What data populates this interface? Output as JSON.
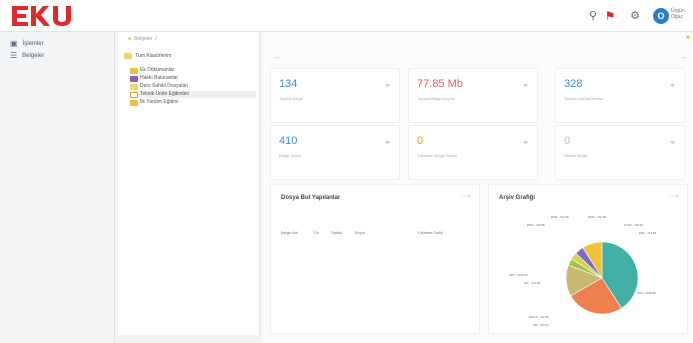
{
  "brand": {
    "logo_text": "EKU",
    "logo_color": "#e02a2a"
  },
  "header": {
    "icons": [
      "search-icon",
      "notification-icon",
      "settings-icon"
    ],
    "avatar_initial": "O",
    "user_name": "Ürgün Oğuz"
  },
  "sidebar": {
    "items": [
      {
        "label": "İşlemler",
        "icon": "briefcase-icon"
      },
      {
        "label": "Belgeler",
        "icon": "list-icon"
      }
    ]
  },
  "tree": {
    "breadcrumb": "Belgeler",
    "root": "Tüm Klasörlerim",
    "items": [
      {
        "label": "Ek Dökümanlar",
        "icon": "folder",
        "selected": false
      },
      {
        "label": "Hakkı Bulunanlar",
        "icon": "folder-purple",
        "selected": false
      },
      {
        "label": "Ders Sahibi Dosyaları",
        "icon": "folder-open",
        "selected": false
      },
      {
        "label": "Teknik Ünite Eğitimleri",
        "icon": "folder-outline",
        "selected": true
      },
      {
        "label": "İlk Yardım Eğitimi",
        "icon": "folder",
        "selected": false
      }
    ]
  },
  "cards": [
    {
      "value": "134",
      "label": "Toplam Belge",
      "color": "#3d8fd6"
    },
    {
      "value": "77.85 Mb",
      "label": "Toplam Belge Boyutu",
      "color": "#e85c5c"
    },
    {
      "value": "328",
      "label": "Toplam Görüntülenme",
      "color": "#3d8fd6"
    },
    {
      "value": "410",
      "label": "Belge Sayısı",
      "color": "#3d8fd6"
    },
    {
      "value": "0",
      "label": "Yüklenen Belge Sayısı",
      "color": "#f0a020"
    },
    {
      "value": "0",
      "label": "Silinen Belge",
      "color": "#bbbbbb"
    }
  ],
  "table_panel": {
    "title": "Dosya Bul Yapılanlar",
    "columns": [
      "Belge Adı",
      "Tür",
      "Sahibi",
      "Boyut",
      "Yükleme Tarihi"
    ]
  },
  "pie_panel": {
    "title": "Arşiv Grafiği",
    "labels": [
      "DMF - %2.46",
      "PNG - %5.85",
      "DMG - %0.96",
      "XLSX - %0.32",
      "PDF - %4.81",
      "JPG - %40.86",
      "GIF - %3.06",
      "PPT - %25.92",
      "DOCX - %1.83",
      "ZIP - %3.21",
      "PNG - %5.56"
    ]
  },
  "chart_data": {
    "type": "pie",
    "title": "Arşiv Grafiği",
    "series": [
      {
        "name": "JPG",
        "value": 40.86,
        "color": "#43b0a5"
      },
      {
        "name": "PPT",
        "value": 25.92,
        "color": "#ee8050"
      },
      {
        "name": "PNG",
        "value": 14.0,
        "color": "#c8b870"
      },
      {
        "name": "DOCX",
        "value": 3.06,
        "color": "#a4c24a"
      },
      {
        "name": "ZIP",
        "value": 3.21,
        "color": "#d4d050"
      },
      {
        "name": "DMF",
        "value": 4.0,
        "color": "#7c6cc4"
      },
      {
        "name": "PDF",
        "value": 8.95,
        "color": "#f0c23a"
      }
    ]
  }
}
